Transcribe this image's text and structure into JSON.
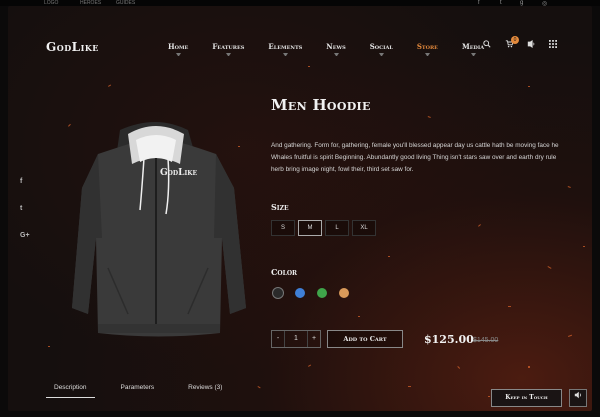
{
  "topbar": {
    "left_items": [
      "LOGO",
      "HEROES",
      "GUIDES"
    ],
    "right_icons": [
      "facebook-icon",
      "twitter-icon",
      "google-plus-icon",
      "instagram-icon"
    ]
  },
  "header": {
    "logo": "GodLike",
    "nav": [
      {
        "label": "Home",
        "has_dropdown": true,
        "active": false
      },
      {
        "label": "Features",
        "has_dropdown": true,
        "active": false
      },
      {
        "label": "Elements",
        "has_dropdown": true,
        "active": false
      },
      {
        "label": "News",
        "has_dropdown": true,
        "active": false
      },
      {
        "label": "Social",
        "has_dropdown": true,
        "active": false
      },
      {
        "label": "Store",
        "has_dropdown": true,
        "active": true
      },
      {
        "label": "Media",
        "has_dropdown": true,
        "active": false
      }
    ],
    "icons": [
      "search-icon",
      "cart-icon",
      "user-icon",
      "grid-menu-icon"
    ],
    "cart_count": "0",
    "accent_color": "#e48a3c"
  },
  "social": [
    "f",
    "t",
    "G+"
  ],
  "product": {
    "logo_print": "GodLike",
    "title": "Men Hoodie",
    "description": "And gathering. Form for, gathering, female you'll blessed appear day us cattle hath be moving face he Whales fruitful is spirit Beginning. Abundantly good living Thing isn't stars saw over and earth dry rule herb bring image night, fowl their, third set saw for.",
    "size_label": "Size",
    "sizes": [
      "S",
      "M",
      "L",
      "XL"
    ],
    "selected_size": "M",
    "color_label": "Color",
    "colors": [
      "#2a2a2a",
      "#3f7fd6",
      "#3fa54a",
      "#d99a5a"
    ],
    "selected_color": "#2a2a2a",
    "quantity": "1",
    "qty_minus": "-",
    "qty_plus": "+",
    "add_to_cart": "Add to Cart",
    "price": "$125.00",
    "old_price": "$145.00"
  },
  "tabs": [
    {
      "label": "Description",
      "active": true
    },
    {
      "label": "Parameters",
      "active": false
    },
    {
      "label": "Reviews (3)",
      "active": false
    }
  ],
  "footer": {
    "keep_in_touch": "Keep in Touch",
    "volume_icon": "volume-icon"
  }
}
